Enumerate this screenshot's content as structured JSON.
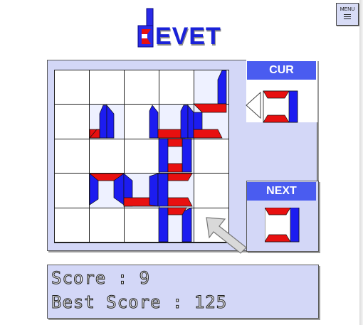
{
  "app": {
    "logo_text": "EVET"
  },
  "menu": {
    "label": "MENU"
  },
  "side": {
    "cur_label": "CUR",
    "next_label": "NEXT"
  },
  "score": {
    "line1": "Score : 9",
    "line2": "Best Score : 125"
  },
  "colors": {
    "blue": "#1c1cf0",
    "red": "#e81010",
    "panel": "#d3d7f7",
    "header": "#4a5cf0"
  },
  "icons": {
    "menu": "hamburger-icon",
    "pointer": "arrow-cursor-icon",
    "direction": "left-triangle-icon"
  }
}
